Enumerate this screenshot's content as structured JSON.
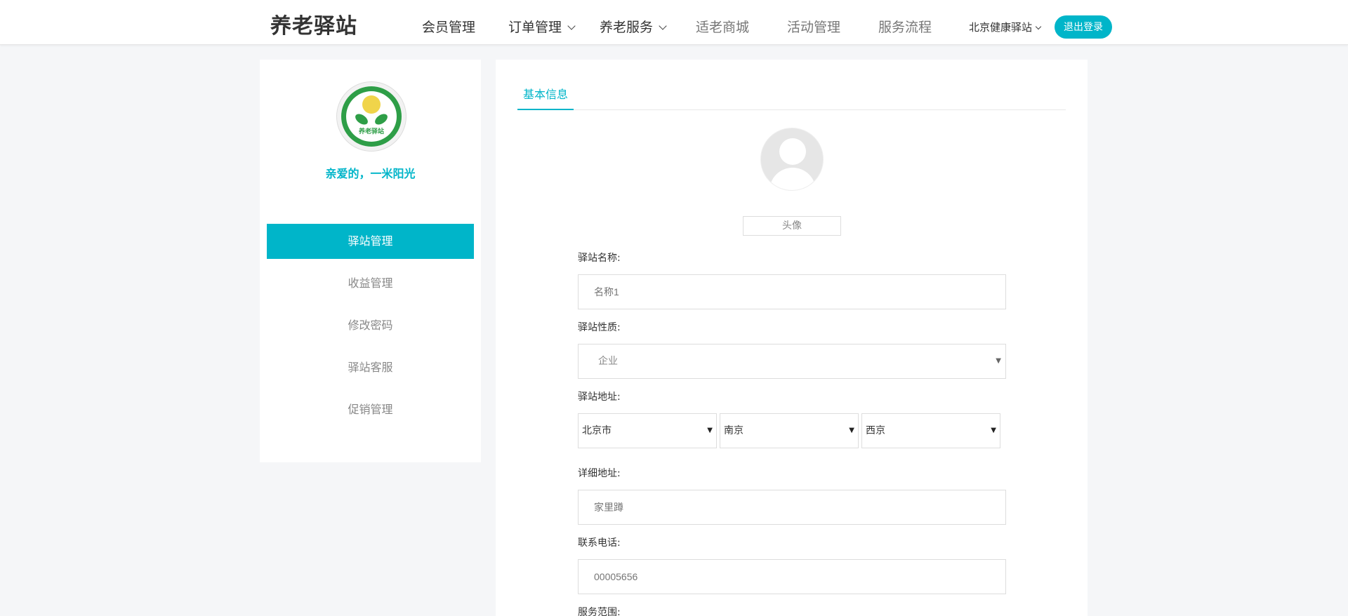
{
  "header": {
    "brand": "养老驿站",
    "nav": [
      {
        "label": "会员管理"
      },
      {
        "label": "订单管理"
      },
      {
        "label": "养老服务"
      },
      {
        "label": "适老商城"
      },
      {
        "label": "活动管理"
      },
      {
        "label": "服务流程"
      }
    ],
    "station": "北京健康驿站",
    "logout": "退出登录"
  },
  "sidebar": {
    "logo_text": "养老驿站",
    "greeting": "亲爱的，一米阳光",
    "items": [
      {
        "label": "驿站管理",
        "active": true
      },
      {
        "label": "收益管理"
      },
      {
        "label": "修改密码"
      },
      {
        "label": "驿站客服"
      },
      {
        "label": "促销管理"
      }
    ]
  },
  "main": {
    "tab": "基本信息",
    "portrait_label": "头像",
    "fields": {
      "name": {
        "label": "驿站名称:",
        "placeholder": "名称1"
      },
      "nature": {
        "label": "驿站性质:",
        "value": "企业"
      },
      "address": {
        "label": "驿站地址:",
        "province": "北京市",
        "city": "南京",
        "district": "西京"
      },
      "detail": {
        "label": "详细地址:",
        "placeholder": "家里蹲"
      },
      "phone": {
        "label": "联系电话:",
        "placeholder": "00005656"
      },
      "scope": {
        "label": "服务范围:"
      }
    }
  },
  "colors": {
    "accent": "#00b5c9"
  }
}
